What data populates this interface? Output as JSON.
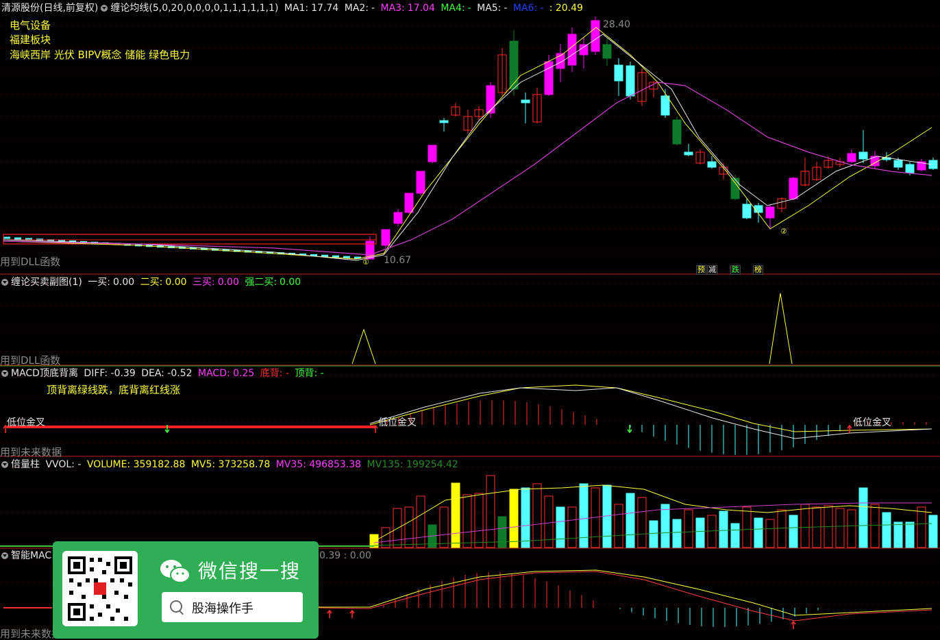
{
  "colors": {
    "bg": "#000000",
    "up": "#ff2a2a",
    "up_fill": "#ff00ff",
    "down": "#54ffff",
    "down_dark": "#0f7a2a",
    "yellow": "#ffff40",
    "ma_white": "#e8e8e8",
    "ma_magenta": "#d040d0",
    "grid": "#5a0000"
  },
  "main": {
    "title": "清源股份(日线,前复权)",
    "indicator": "缠论均线(5,0,20,0,0,0,0,1,1,1,1,1,1)",
    "ma1_label": "MA1:",
    "ma1_value": "17.74",
    "ma2_label": "MA2:",
    "ma2_value": "-",
    "ma3_label": "MA3:",
    "ma3_value": "17.04",
    "ma4_label": "MA4:",
    "ma4_value": "-",
    "ma5_label": "MA5:",
    "ma5_value": "-",
    "ma6_label": "MA6:",
    "ma6_value": "-",
    "extra": ": 20.49",
    "sectors": [
      "电气设备",
      "福建板块",
      "海峡西岸 光伏 BIPV概念 储能 绿色电力"
    ],
    "high_label": "28.40",
    "low_label": "10.67",
    "footer": "用到DLL函数",
    "mark1": "①",
    "mark2": "②",
    "tags": [
      "预",
      "减",
      "跌",
      "榜"
    ]
  },
  "panel2": {
    "title": "缠论买卖副图(1)",
    "b1_label": "一买:",
    "b1_value": "0.00",
    "b2_label": "二买:",
    "b2_value": "0.00",
    "b3_label": "三买:",
    "b3_value": "0.00",
    "sb2_label": "强二买:",
    "sb2_value": "0.00",
    "footer": "用到DLL函数"
  },
  "panel3": {
    "title": "MACD顶底背离",
    "diff": "DIFF: -0.39",
    "dea": "DEA: -0.52",
    "macd": "MACD: 0.25",
    "bottom_div": "底背: -",
    "top_div": "顶背: -",
    "note": "顶背离绿线跌，底背离红线涨",
    "gold1": "低位金叉",
    "gold2": "低位金叉",
    "gold3": "低位金叉",
    "footer": "用到未来数据"
  },
  "panel4": {
    "title": "倍量柱",
    "vvol": "VVOL: -",
    "volume": "VOLUME: 359182.88",
    "mv5": "MV5: 373258.78",
    "mv35": "MV35: 496853.38",
    "mv135": "MV135: 199254.42"
  },
  "panel5": {
    "title": "智能MAC",
    "value": "0.39 : 0.00",
    "footer": "用到未来数据"
  },
  "overlay": {
    "title": "微信搜一搜",
    "search_text": "股海操作手"
  }
}
